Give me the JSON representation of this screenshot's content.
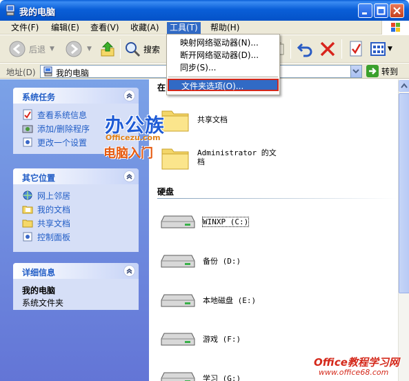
{
  "window": {
    "title": "我的电脑"
  },
  "menubar": {
    "items": [
      "文件(F)",
      "编辑(E)",
      "查看(V)",
      "收藏(A)",
      "工具(T)",
      "帮助(H)"
    ],
    "active_index": 4
  },
  "toolbar": {
    "back_label": "后退",
    "search_label": "搜索"
  },
  "address": {
    "label": "地址(D)",
    "value": "我的电脑",
    "go_label": "转到"
  },
  "tools_menu": {
    "items": [
      "映射网络驱动器(N)...",
      "断开网络驱动器(D)...",
      "同步(S)...",
      "文件夹选项(O)..."
    ],
    "highlighted_index": 3
  },
  "left_pane": {
    "system_tasks": {
      "title": "系统任务",
      "items": [
        "查看系统信息",
        "添加/删除程序",
        "更改一个设置"
      ]
    },
    "other_places": {
      "title": "其它位置",
      "items": [
        "网上邻居",
        "我的文档",
        "共享文档",
        "控制面板"
      ]
    },
    "details": {
      "title": "详细信息",
      "name": "我的电脑",
      "type": "系统文件夹"
    }
  },
  "content": {
    "group1_header": "在",
    "folders": [
      "共享文档",
      "Administrator 的文档"
    ],
    "group2_header": "硬盘",
    "drives": [
      "WINXP (C:)",
      "备份 (D:)",
      "本地磁盘 (E:)",
      "游戏 (F:)",
      "学习 (G:)"
    ]
  },
  "watermarks": {
    "logo_cn": "办公族",
    "logo_en": "Officezu.com",
    "logo_sub": "电脑入门",
    "corner_title": "Office教程学习网",
    "corner_url": "www.office68.com"
  }
}
